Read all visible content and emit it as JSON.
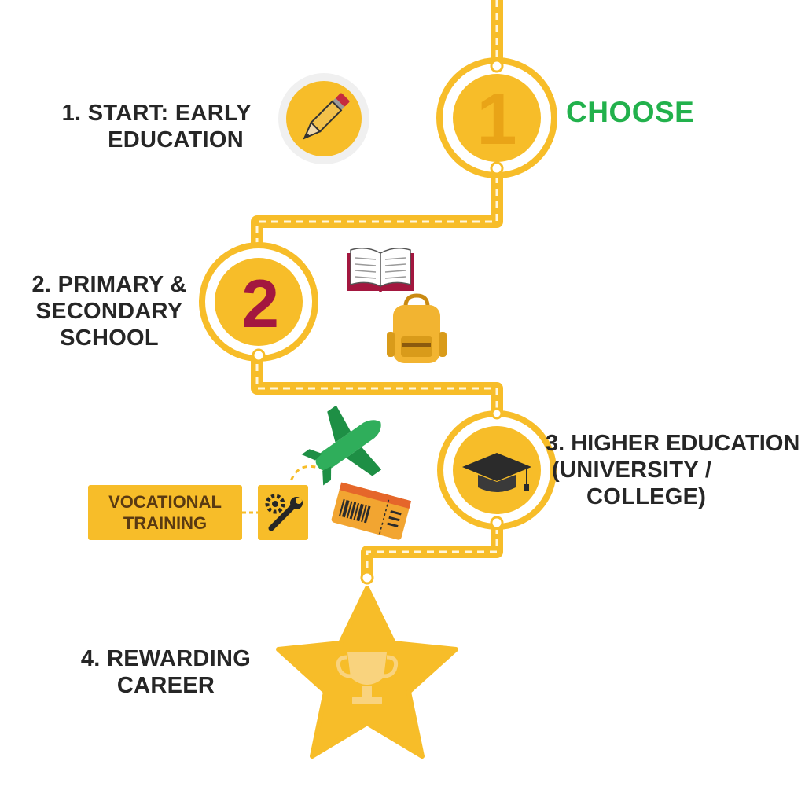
{
  "steps": [
    {
      "number": "1",
      "lines": [
        "1. START: EARLY",
        "EDUCATION"
      ]
    },
    {
      "number": "2",
      "lines": [
        "2. PRIMARY &",
        "SECONDARY",
        "SCHOOL"
      ]
    },
    {
      "lines": [
        "3. HIGHER EDUCATION",
        "(UNIVERSITY /",
        "COLLEGE)"
      ]
    },
    {
      "lines": [
        "4. REWARDING",
        "CAREER"
      ]
    }
  ],
  "choose_label": "CHOOSE",
  "vocational": {
    "lines": [
      "VOCATIONAL",
      "TRAINING"
    ]
  },
  "icons": [
    "pencil-icon",
    "open-book-icon",
    "backpack-icon",
    "airplane-icon",
    "gear-wrench-icon",
    "ticket-icon",
    "graduation-cap-icon",
    "trophy-icon",
    "star-icon"
  ],
  "colors": {
    "path": "#f7bd29",
    "path_dash": "#fff6dc",
    "circle": "#f7bd29",
    "accent_green": "#22b14c",
    "number_two": "#a3173f",
    "text": "#262626"
  }
}
